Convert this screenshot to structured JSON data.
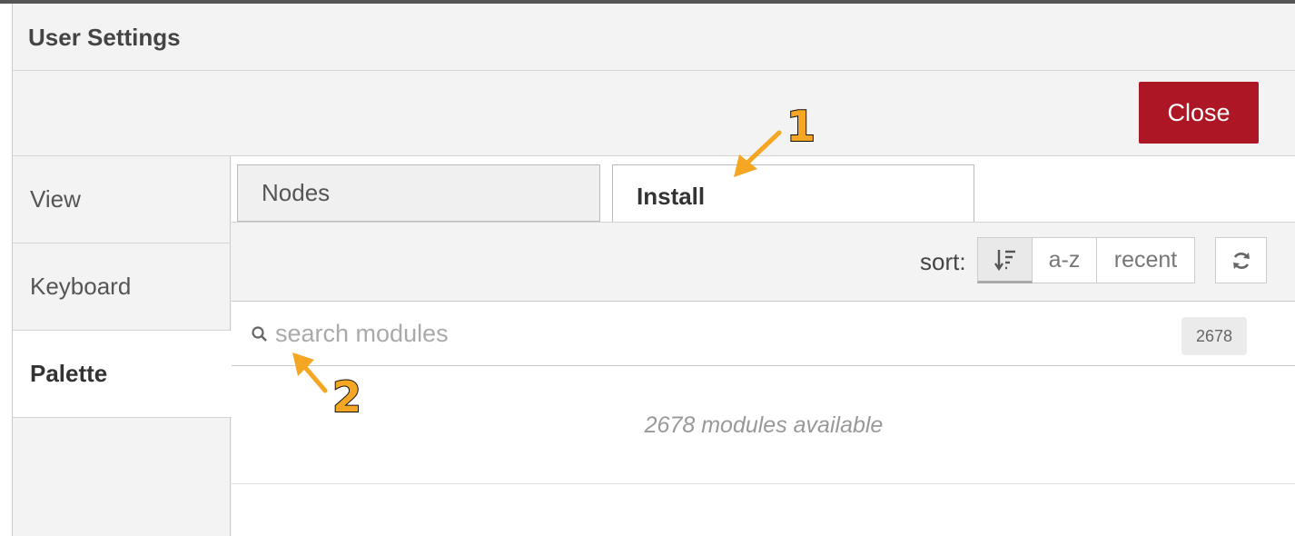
{
  "header": {
    "title": "User Settings"
  },
  "buttons": {
    "close_label": "Close"
  },
  "sidebar": {
    "items": [
      {
        "label": "View"
      },
      {
        "label": "Keyboard"
      },
      {
        "label": "Palette"
      }
    ],
    "active": "Palette"
  },
  "tabs": [
    {
      "label": "Nodes"
    },
    {
      "label": "Install"
    }
  ],
  "active_tab": "Install",
  "toolbar": {
    "sort_label": "sort:",
    "sort_options": [
      {
        "label": "",
        "icon": "sort-relevance-icon"
      },
      {
        "label": "a-z"
      },
      {
        "label": "recent"
      }
    ],
    "refresh_icon": "refresh-icon"
  },
  "search": {
    "placeholder": "search modules",
    "count": "2678"
  },
  "results": {
    "message": "2678 modules available"
  },
  "annotations": [
    {
      "label": "1"
    },
    {
      "label": "2"
    }
  ],
  "colors": {
    "close_button": "#ad1625",
    "annotation": "#f5a623"
  }
}
